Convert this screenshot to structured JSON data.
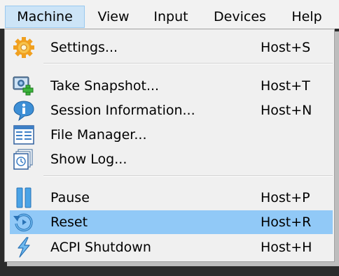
{
  "menubar": {
    "items": [
      {
        "label": "Machine",
        "active": true
      },
      {
        "label": "View",
        "active": false
      },
      {
        "label": "Input",
        "active": false
      },
      {
        "label": "Devices",
        "active": false
      },
      {
        "label": "Help",
        "active": false
      }
    ]
  },
  "menu": {
    "items": [
      {
        "label": "Settings...",
        "shortcut": "Host+S",
        "icon": "gear-icon"
      },
      {
        "label": "Take Snapshot...",
        "shortcut": "Host+T",
        "icon": "snapshot-icon"
      },
      {
        "label": "Session Information...",
        "shortcut": "Host+N",
        "icon": "info-icon"
      },
      {
        "label": "File Manager...",
        "shortcut": "",
        "icon": "file-manager-icon"
      },
      {
        "label": "Show Log...",
        "shortcut": "",
        "icon": "log-icon"
      },
      {
        "label": "Pause",
        "shortcut": "Host+P",
        "icon": "pause-icon"
      },
      {
        "label": "Reset",
        "shortcut": "Host+R",
        "icon": "reset-icon",
        "highlighted": true
      },
      {
        "label": "ACPI Shutdown",
        "shortcut": "Host+H",
        "icon": "acpi-shutdown-icon"
      }
    ]
  },
  "colors": {
    "highlight": "#91c9f7",
    "menubar_active": "#cce4f7",
    "menu_bg": "#f0f0f0",
    "icon_blue": "#3d8fd6"
  }
}
